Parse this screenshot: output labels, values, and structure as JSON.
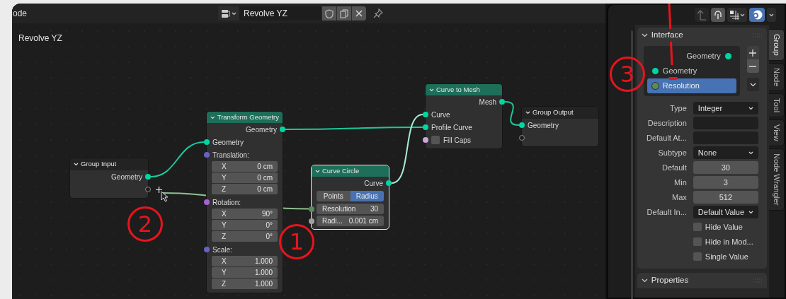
{
  "editor": {
    "mode_label": "ode",
    "node_group": {
      "name": "Revolve YZ"
    },
    "breadcrumb": "Revolve YZ"
  },
  "nodes": [
    {
      "title": "Group Input",
      "kind": "group",
      "selected": false,
      "rows": [
        {
          "kind": "output",
          "label": "Geometry",
          "color": "#00d6a3"
        },
        {
          "kind": "new_output"
        }
      ]
    },
    {
      "title": "Transform Geometry",
      "kind": "geometry",
      "selected": false,
      "rows": [
        {
          "kind": "output",
          "label": "Geometry",
          "color": "#00d6a3"
        },
        {
          "kind": "input",
          "label": "Geometry",
          "color": "#00d6a3"
        },
        {
          "kind": "vector",
          "label": "Translation:",
          "color": "#6363c7",
          "fields": [
            {
              "label": "X",
              "value": "0 cm"
            },
            {
              "label": "Y",
              "value": "0 cm"
            },
            {
              "label": "Z",
              "value": "0 cm"
            }
          ]
        },
        {
          "kind": "vector",
          "label": "Rotation:",
          "color": "#a363d6",
          "fields": [
            {
              "label": "X",
              "value": "90°"
            },
            {
              "label": "Y",
              "value": "0°"
            },
            {
              "label": "Z",
              "value": "0°"
            }
          ]
        },
        {
          "kind": "vector",
          "label": "Scale:",
          "color": "#6363c7",
          "fields": [
            {
              "label": "X",
              "value": "1.000"
            },
            {
              "label": "Y",
              "value": "1.000"
            },
            {
              "label": "Z",
              "value": "1.000"
            }
          ]
        }
      ]
    },
    {
      "title": "Curve Circle",
      "kind": "geometry",
      "selected": true,
      "rows": [
        {
          "kind": "output",
          "label": "Curve",
          "color": "#00d6a3"
        },
        {
          "kind": "segmented",
          "options": [
            {
              "label": "Points",
              "selected": false
            },
            {
              "label": "Radius",
              "selected": true
            }
          ]
        },
        {
          "kind": "socket_field",
          "label": "Resolution",
          "value": "30",
          "color": "#598c5c"
        },
        {
          "kind": "socket_field",
          "label": "Radi...",
          "value": "0.001 cm",
          "color": "#a1a1a1"
        }
      ]
    },
    {
      "title": "Curve to Mesh",
      "kind": "geometry",
      "selected": false,
      "rows": [
        {
          "kind": "output",
          "label": "Mesh",
          "color": "#00d6a3"
        },
        {
          "kind": "input",
          "label": "Curve",
          "color": "#00d6a3"
        },
        {
          "kind": "input",
          "label": "Profile Curve",
          "color": "#00d6a3"
        },
        {
          "kind": "checkbox",
          "label": "Fill Caps",
          "checked": false,
          "color": "#cca6d6"
        }
      ]
    },
    {
      "title": "Group Output",
      "kind": "group",
      "selected": false,
      "rows": [
        {
          "kind": "input",
          "label": "Geometry",
          "color": "#00d6a3"
        },
        {
          "kind": "new_input"
        }
      ]
    }
  ],
  "sidebar": {
    "interface": {
      "title": "Interface",
      "expanded": true,
      "items": [
        {
          "label": "Geometry",
          "kind": "output",
          "selected": false,
          "color": "#00d6a3"
        },
        {
          "label": "Geometry",
          "kind": "input",
          "selected": false,
          "color": "#00d6a3"
        },
        {
          "label": "Resolution",
          "kind": "input",
          "selected": true,
          "color": "#598c5c"
        }
      ],
      "properties": [
        {
          "kind": "dropdown",
          "label": "Type",
          "value": "Integer"
        },
        {
          "kind": "text",
          "label": "Description"
        },
        {
          "kind": "text",
          "label": "Default At..."
        },
        {
          "kind": "dropdown",
          "label": "Subtype",
          "value": "None"
        },
        {
          "kind": "number",
          "label": "Default",
          "value": "30"
        },
        {
          "kind": "number",
          "label": "Min",
          "value": "3"
        },
        {
          "kind": "number",
          "label": "Max",
          "value": "512"
        },
        {
          "kind": "dropdown",
          "label": "Default In...",
          "value": "Default Value"
        },
        {
          "kind": "checkbox",
          "label": "Hide Value",
          "checked": false
        },
        {
          "kind": "checkbox",
          "label": "Hide in Mod...",
          "checked": false
        },
        {
          "kind": "checkbox",
          "label": "Single Value",
          "checked": false
        }
      ]
    },
    "second_panel": {
      "title": "Properties",
      "expanded": true
    },
    "tabs": [
      {
        "label": "Group",
        "selected": true
      },
      {
        "label": "Node",
        "selected": false
      },
      {
        "label": "Tool",
        "selected": false
      },
      {
        "label": "View",
        "selected": false
      },
      {
        "label": "Node Wrangler",
        "selected": false
      }
    ]
  },
  "annotations": [
    {
      "label": "1"
    },
    {
      "label": "2"
    },
    {
      "label": "3"
    }
  ]
}
